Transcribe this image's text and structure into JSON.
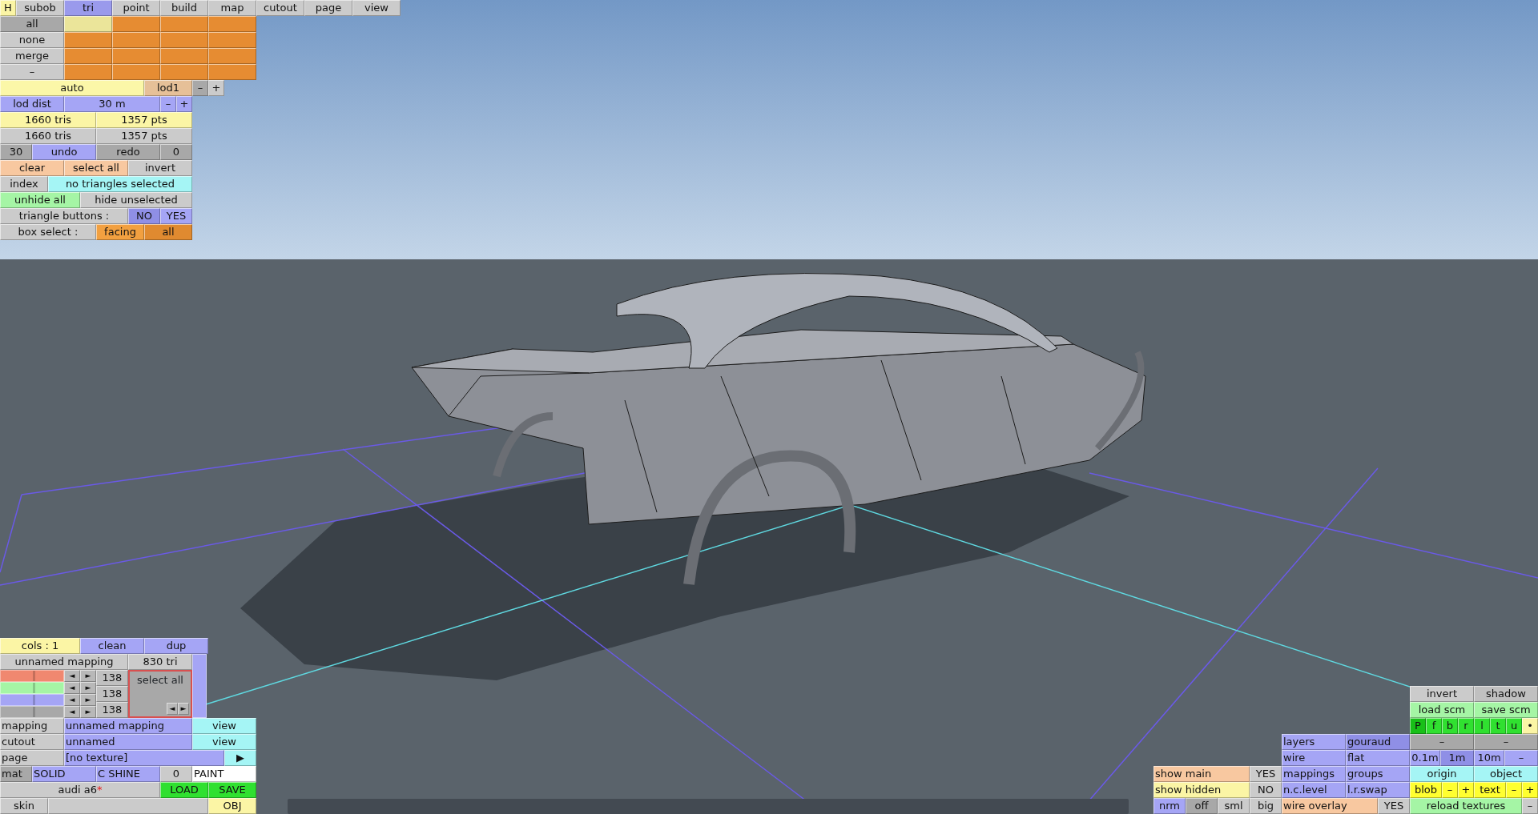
{
  "top_panel": {
    "buttons": [
      {
        "label": "H",
        "color": "#fbf5a5"
      },
      {
        "label": "subob",
        "color": "#cbcbcb"
      },
      {
        "label": "tri",
        "color": "#9a9aec"
      },
      {
        "label": "point",
        "color": "#cbcbcb"
      },
      {
        "label": "build",
        "color": "#cbcbcb"
      },
      {
        "label": "map",
        "color": "#cbcbcb"
      },
      {
        "label": "cutout",
        "color": "#cbcbcb"
      },
      {
        "label": "page",
        "color": "#cbcbcb"
      },
      {
        "label": "view",
        "color": "#cbcbcb"
      },
      {
        "label": "all",
        "color": "#a8a8a8"
      },
      {
        "color": "#ebe59a"
      },
      {
        "color": "#e68c32"
      },
      {
        "color": "#e68c32"
      },
      {
        "color": "#e68c32"
      },
      {
        "label": "none",
        "color": "#cbcbcb"
      },
      {
        "color": "#e68c32"
      },
      {
        "color": "#e68c32"
      },
      {
        "color": "#e68c32"
      },
      {
        "color": "#e68c32"
      },
      {
        "label": "merge",
        "color": "#cbcbcb"
      },
      {
        "color": "#e68c32"
      },
      {
        "color": "#e68c32"
      },
      {
        "color": "#e68c32"
      },
      {
        "color": "#e68c32"
      },
      {
        "label": "–",
        "color": "#cbcbcb"
      },
      {
        "color": "#e68c32"
      },
      {
        "color": "#e68c32"
      },
      {
        "color": "#e68c32"
      },
      {
        "color": "#e68c32"
      },
      {
        "label": "auto",
        "color": "#fbf7a8"
      },
      {
        "label": "lod1",
        "color": "#e6c098"
      },
      {
        "label": "–",
        "color": "#a8a8a8"
      },
      {
        "label": "+",
        "color": "#cbcbcb"
      },
      {
        "label": "lod dist",
        "color": "#a5a5f5"
      },
      {
        "label": "30 m",
        "color": "#a5a5f5"
      },
      {
        "label": "–",
        "color": "#a5a5f5"
      },
      {
        "label": "+",
        "color": "#a5a5f5"
      },
      {
        "label": "1660 tris",
        "color": "#fbf5a5"
      },
      {
        "label": "1357 pts",
        "color": "#fbf5a5"
      },
      {
        "label": "1660 tris",
        "color": "#cbcbcb"
      },
      {
        "label": "1357 pts",
        "color": "#cbcbcb"
      },
      {
        "label": "30",
        "color": "#a8a8a8"
      },
      {
        "label": "undo",
        "color": "#a5a5f5"
      },
      {
        "label": "redo",
        "color": "#a8a8a8"
      },
      {
        "label": "0",
        "color": "#a8a8a8"
      },
      {
        "label": "clear",
        "color": "#f8c8a0"
      },
      {
        "label": "select all",
        "color": "#f8c8a0"
      },
      {
        "label": "invert",
        "color": "#cbcbcb"
      },
      {
        "label": "index",
        "color": "#cbcbcb"
      },
      {
        "label": "no triangles selected",
        "color": "#a5f5f5"
      },
      {
        "label": "unhide all",
        "color": "#a5f5a5"
      },
      {
        "label": "hide unselected",
        "color": "#cbcbcb"
      },
      {
        "label": "triangle buttons :",
        "color": "#cbcbcb"
      },
      {
        "label": "NO",
        "color": "#8f8fe6"
      },
      {
        "label": "YES",
        "color": "#a5a5f5"
      },
      {
        "label": "box select :",
        "color": "#cbcbcb"
      },
      {
        "label": "facing",
        "color": "#f2a040"
      },
      {
        "label": "all",
        "color": "#e08a30"
      }
    ]
  },
  "mapping_panel": {
    "header_buttons": [
      {
        "label": "cols : 1",
        "color": "#fbf5a5"
      },
      {
        "label": "clean",
        "color": "#a5a5f5"
      },
      {
        "label": "dup",
        "color": "#a5a5f5"
      },
      {
        "label": "unnamed mapping",
        "color": "#cbcbcb"
      },
      {
        "label": "830 tri",
        "color": "#cbcbcb"
      }
    ],
    "layers": {
      "sliders": [
        {
          "color": "#f08870",
          "level": 0.53,
          "left": "◄",
          "right": "►"
        },
        {
          "color": "#a5f5a5",
          "level": 0.53,
          "left": "◄",
          "right": "►"
        },
        {
          "color": "#a5a5f5",
          "level": 0.53,
          "left": "◄",
          "right": "►"
        },
        {
          "color": "#a8a8a8",
          "level": 0.53,
          "left": "◄",
          "right": "►"
        }
      ],
      "counts": [
        "138",
        "138",
        "138"
      ],
      "select_box": {
        "label": "select all",
        "left": "◄",
        "right": "►"
      }
    },
    "buttons": [
      {
        "label": "mapping",
        "color": "#cbcbcb"
      },
      {
        "label": "unnamed mapping",
        "color": "#a5a5f5"
      },
      {
        "label": "view",
        "color": "#a5f5f5"
      },
      {
        "label": "cutout",
        "color": "#cbcbcb"
      },
      {
        "label": "unnamed",
        "color": "#a5a5f5"
      },
      {
        "label": "view",
        "color": "#a5f5f5"
      },
      {
        "label": "page",
        "color": "#cbcbcb"
      },
      {
        "label": "[no texture]",
        "color": "#a5a5f5"
      },
      {
        "label": "▶",
        "color": "#a5f5f5"
      },
      {
        "label": "mat",
        "color": "#a8a8a8"
      },
      {
        "label": "SOLID",
        "color": "#a5a5f5"
      },
      {
        "label": "C SHINE",
        "color": "#a5a5f5"
      },
      {
        "label": "0",
        "color": "#cbcbcb"
      },
      {
        "label": "PAINT",
        "color": "#ffffff"
      },
      {
        "label": "audi a6",
        "mark": "*",
        "color": "#cbcbcb"
      },
      {
        "label": "LOAD",
        "color": "#30e030"
      },
      {
        "label": "SAVE",
        "color": "#30e030"
      },
      {
        "label": "skin",
        "color": "#cbcbcb"
      },
      {
        "color": "#cbcbcb"
      },
      {
        "label": "OBJ",
        "color": "#fbf5a5"
      }
    ]
  },
  "view_panel": {
    "buttons": [
      {
        "label": "invert",
        "color": "#cbcbcb"
      },
      {
        "label": "shadow",
        "color": "#c0c0c0"
      },
      {
        "label": "load scm",
        "color": "#a5f5a5"
      },
      {
        "label": "save scm",
        "color": "#a5f5a5"
      },
      {
        "label": "P",
        "color": "#18c018"
      },
      {
        "label": "f",
        "color": "#30e030"
      },
      {
        "label": "b",
        "color": "#30e030"
      },
      {
        "label": "r",
        "color": "#30e030"
      },
      {
        "label": "l",
        "color": "#30e030"
      },
      {
        "label": "t",
        "color": "#30e030"
      },
      {
        "label": "u",
        "color": "#30e030"
      },
      {
        "label": "•",
        "color": "#fbf5a5"
      },
      {
        "label": "–",
        "color": "#a8a8a8"
      },
      {
        "label": "–",
        "color": "#a8a8a8"
      },
      {
        "label": "0.1m",
        "color": "#a5a5f5"
      },
      {
        "label": "1m",
        "color": "#8f8fe6"
      },
      {
        "label": "10m",
        "color": "#a5a5f5"
      },
      {
        "label": "–",
        "color": "#a5a5f5"
      },
      {
        "label": "origin",
        "color": "#a5f5f5"
      },
      {
        "label": "object",
        "color": "#a5f5f5"
      },
      {
        "label": "blob",
        "color": "#ffff30"
      },
      {
        "label": "–",
        "color": "#ffff30"
      },
      {
        "label": "+",
        "color": "#ffff30"
      },
      {
        "label": "text",
        "color": "#ffff30"
      },
      {
        "label": "–",
        "color": "#ffff30"
      },
      {
        "label": "+",
        "color": "#ffff30"
      },
      {
        "label": "reload textures",
        "color": "#a5f5a5"
      },
      {
        "label": "–",
        "color": "#cbcbcb"
      }
    ]
  },
  "render_panel": {
    "buttons": [
      {
        "label": "layers",
        "color": "#a5a5f5"
      },
      {
        "label": "gouraud",
        "color": "#8f8fe6"
      },
      {
        "label": "wire",
        "color": "#a5a5f5"
      },
      {
        "label": "flat",
        "color": "#a5a5f5"
      },
      {
        "label": "mappings",
        "color": "#a5a5f5"
      },
      {
        "label": "groups",
        "color": "#a5a5f5"
      },
      {
        "label": "n.c.level",
        "color": "#a5a5f5"
      },
      {
        "label": "l.r.swap",
        "color": "#a5a5f5"
      },
      {
        "label": "wire overlay",
        "color": "#f8c8a0"
      },
      {
        "label": "YES",
        "color": "#cbcbcb"
      }
    ]
  },
  "display_panel": {
    "buttons": [
      {
        "label": "show main",
        "color": "#f8c8a0"
      },
      {
        "label": "YES",
        "color": "#cbcbcb"
      },
      {
        "label": "show hidden",
        "color": "#fbf5a5"
      },
      {
        "label": "NO",
        "color": "#cbcbcb"
      },
      {
        "label": "nrm",
        "color": "#a5a5f5"
      },
      {
        "label": "off",
        "color": "#a8a8a8"
      },
      {
        "label": "sml",
        "color": "#cbcbcb"
      },
      {
        "label": "big",
        "color": "#cbcbcb"
      }
    ]
  }
}
